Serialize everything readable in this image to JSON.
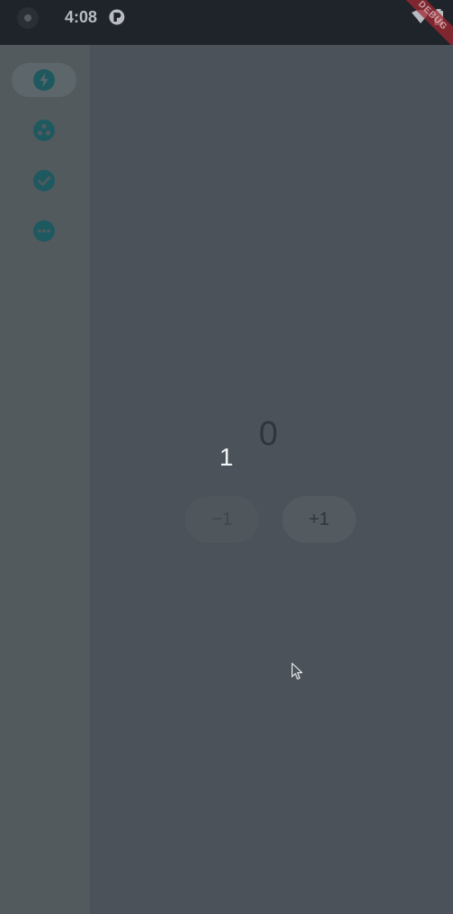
{
  "status_bar": {
    "time": "4:08",
    "debug_label": "DEBUG"
  },
  "nav_rail": {
    "items": [
      {
        "icon": "bolt-icon",
        "selected": true
      },
      {
        "icon": "group-work-icon",
        "selected": false
      },
      {
        "icon": "check-circle-icon",
        "selected": false
      },
      {
        "icon": "more-horiz-icon",
        "selected": false
      }
    ]
  },
  "main": {
    "counter_value": "0",
    "secondary_value": "1",
    "decrement_label": "−1",
    "increment_label": "+1"
  },
  "colors": {
    "icon_teal": "#1f5960",
    "status_bar_bg": "#1f232a",
    "rail_bg": "#535a5e",
    "content_bg": "#4b525a"
  }
}
